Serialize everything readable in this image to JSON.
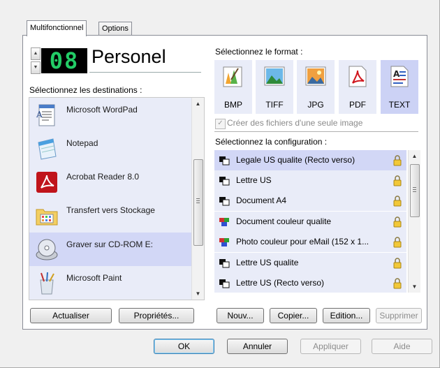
{
  "tabs": [
    {
      "label": "Multifonctionnel"
    },
    {
      "label": "Options"
    }
  ],
  "profile": {
    "number": "08",
    "name": "Personel"
  },
  "destinations": {
    "heading": "Sélectionnez les destinations :",
    "items": [
      {
        "label": "Microsoft WordPad",
        "icon": "wordpad-icon"
      },
      {
        "label": "Notepad",
        "icon": "notepad-icon"
      },
      {
        "label": "Acrobat Reader 8.0",
        "icon": "acrobat-icon"
      },
      {
        "label": "Transfert vers Stockage",
        "icon": "folder-storage-icon"
      },
      {
        "label": "Graver sur CD-ROM  E:",
        "icon": "cdrom-icon",
        "selected": true
      },
      {
        "label": "Microsoft Paint",
        "icon": "paint-icon"
      }
    ],
    "buttons": {
      "refresh": "Actualiser",
      "properties": "Propriétés..."
    }
  },
  "format": {
    "heading": "Sélectionnez le format :",
    "items": [
      {
        "label": "BMP",
        "icon": "bmp-icon"
      },
      {
        "label": "TIFF",
        "icon": "tiff-icon"
      },
      {
        "label": "JPG",
        "icon": "jpg-icon"
      },
      {
        "label": "PDF",
        "icon": "pdf-icon"
      },
      {
        "label": "TEXT",
        "icon": "text-icon",
        "selected": true
      }
    ],
    "single_image_checkbox": {
      "label": "Créer des fichiers d'une seule image",
      "checked": true,
      "disabled": true
    }
  },
  "configuration": {
    "heading": "Sélectionnez la configuration :",
    "items": [
      {
        "label": "Legale US qualite (Recto verso)",
        "icon": "bw-config-icon",
        "selected": true
      },
      {
        "label": "Lettre US",
        "icon": "bw-config-icon"
      },
      {
        "label": "Document A4",
        "icon": "bw-config-icon"
      },
      {
        "label": "Document couleur qualite",
        "icon": "color-config-icon"
      },
      {
        "label": "Photo couleur pour eMail (152 x 1...",
        "icon": "color-config-icon"
      },
      {
        "label": "Lettre US qualite",
        "icon": "bw-config-icon"
      },
      {
        "label": "Lettre US (Recto verso)",
        "icon": "bw-config-icon"
      }
    ],
    "buttons": {
      "new": "Nouv...",
      "copy": "Copier...",
      "edit": "Edition...",
      "delete": "Supprimer"
    }
  },
  "footer": {
    "ok": "OK",
    "cancel": "Annuler",
    "apply": "Appliquer",
    "help": "Aide"
  },
  "colors": {
    "selection": "#d2d7f6",
    "list_bg": "#e9ecf8",
    "lcd_digits": "#22cc66"
  }
}
